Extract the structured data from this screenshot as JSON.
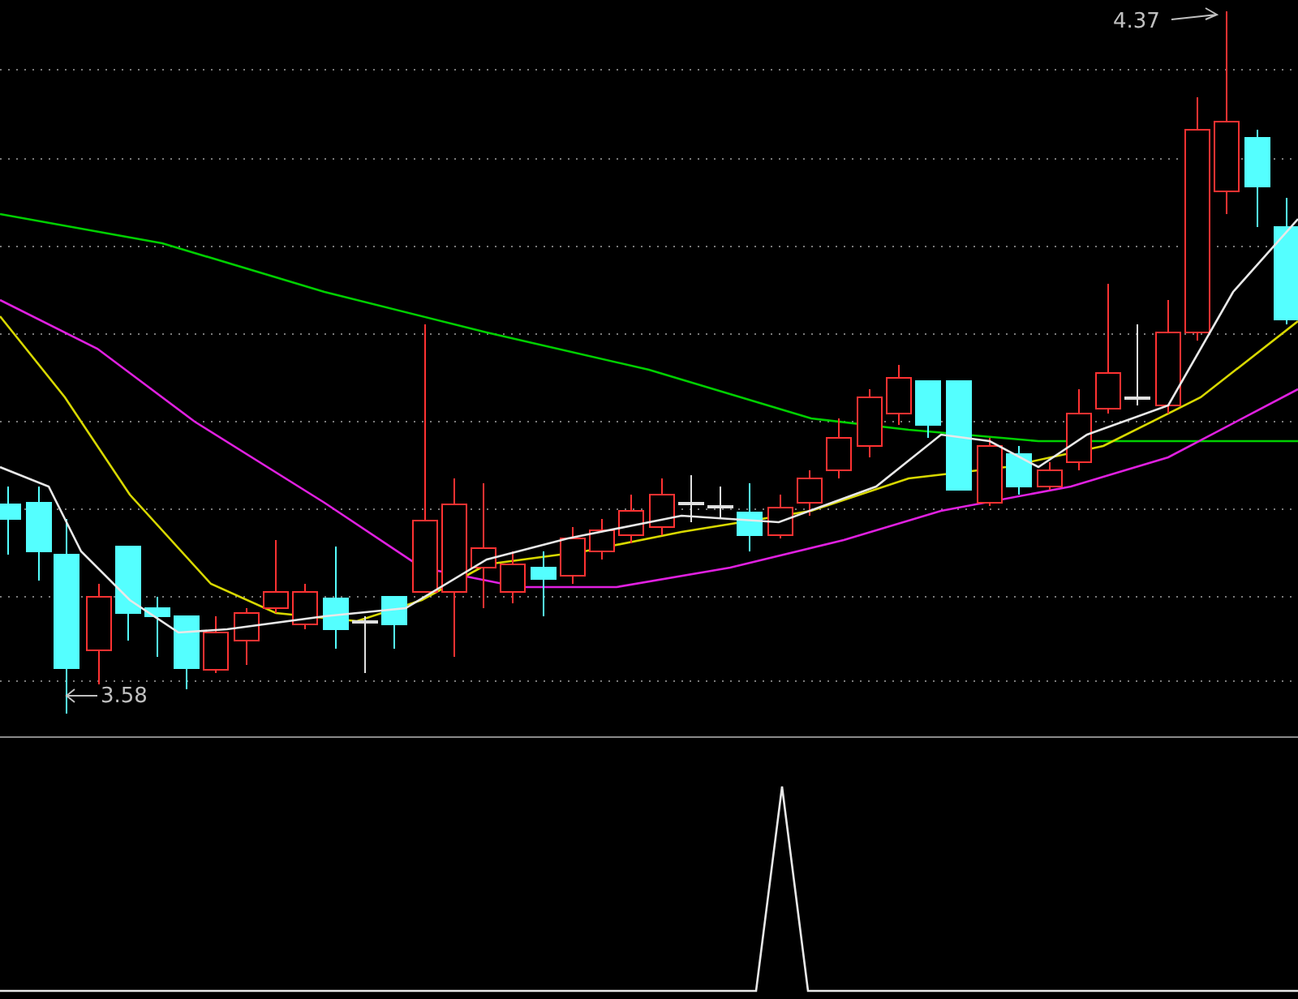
{
  "price_panel": {
    "high_label": "4.37",
    "low_label": "3.58"
  }
}
